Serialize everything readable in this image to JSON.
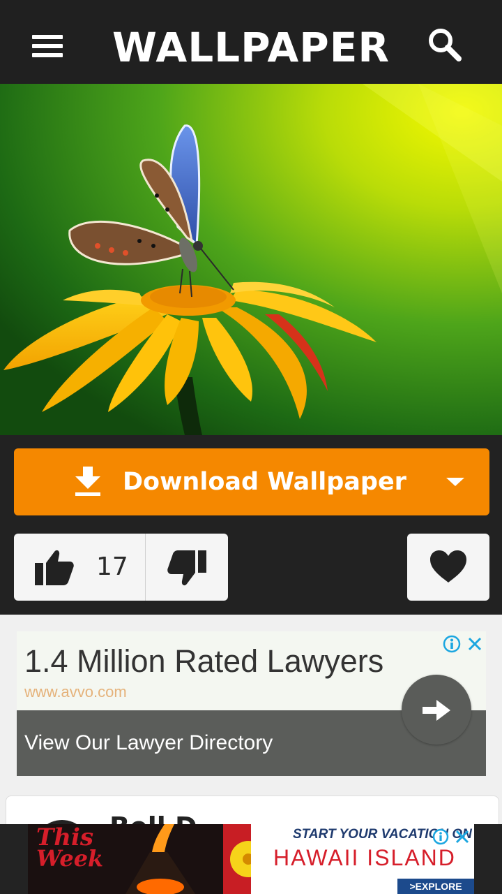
{
  "header": {
    "title": "WALLPAPER"
  },
  "wallpaper": {
    "subject": "butterfly on yellow flower",
    "colors": {
      "background": "#3f9a1a",
      "highlight": "#f0f200",
      "petal": "#f7b400",
      "wing": "#4a6fd0"
    }
  },
  "actions": {
    "download_label": "Download Wallpaper",
    "like_count": "17",
    "accent": "#f58800"
  },
  "ad": {
    "headline": "1.4 Million Rated Lawyers",
    "url": "www.avvo.com",
    "cta": "View Our Lawyer Directory"
  },
  "card": {
    "name_partial": "Bell D..."
  },
  "banner": {
    "brand_line1": "This",
    "brand_line2": "Week",
    "tagline": "START YOUR VACATION ON",
    "place": "HAWAII  ISLAND",
    "button": ">EXPLORE NOW"
  }
}
